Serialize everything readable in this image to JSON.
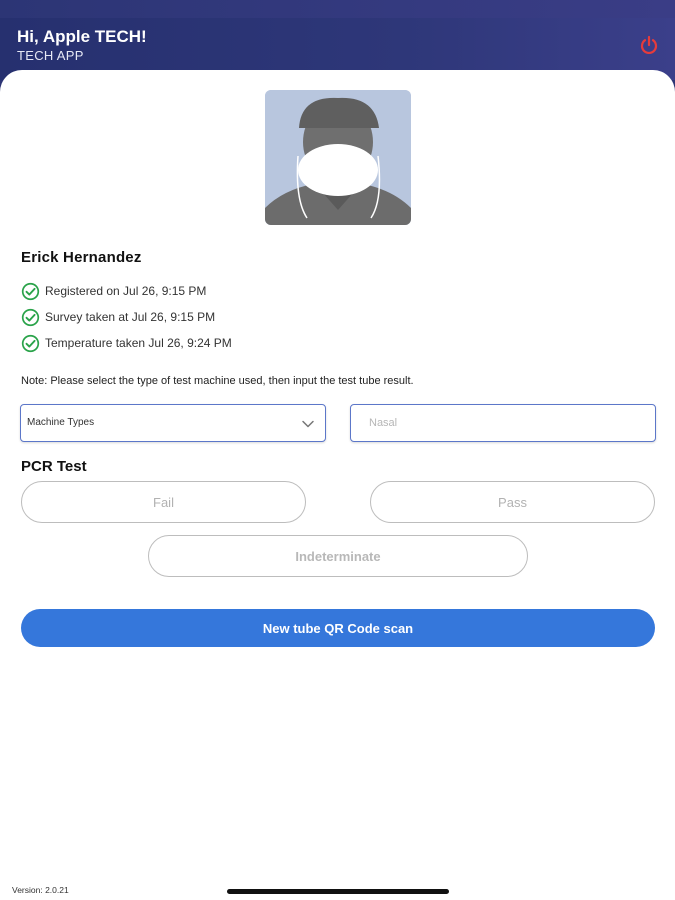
{
  "status_bar": {
    "left_text": "",
    "right_text": ""
  },
  "header": {
    "greeting": "Hi, Apple TECH!",
    "app_name": "TECH APP",
    "power_icon": "power-icon",
    "power_color": "#e63b3b"
  },
  "patient": {
    "name": "Erick Hernandez",
    "checks": [
      {
        "icon": "check-circle-icon",
        "label": "Registered on Jul 26, 9:15 PM"
      },
      {
        "icon": "check-circle-icon",
        "label": "Survey taken at Jul 26, 9:15 PM"
      },
      {
        "icon": "check-circle-icon",
        "label": "Temperature taken Jul 26, 9:24 PM"
      }
    ]
  },
  "note": "Note: Please select the type of test machine used, then input the test tube result.",
  "machine_select": {
    "value": "Machine Types"
  },
  "tube_input": {
    "placeholder": "Nasal",
    "value": ""
  },
  "pcr": {
    "title": "PCR Test",
    "fail_label": "Fail",
    "pass_label": "Pass",
    "indeterminate_label": "Indeterminate"
  },
  "scan_button_label": "New tube QR Code scan",
  "version": "Version: 2.0.21",
  "colors": {
    "header_bg": "#2d3575",
    "accent": "#3577db",
    "check_green": "#2aa34a",
    "input_border": "#5c77c9"
  }
}
